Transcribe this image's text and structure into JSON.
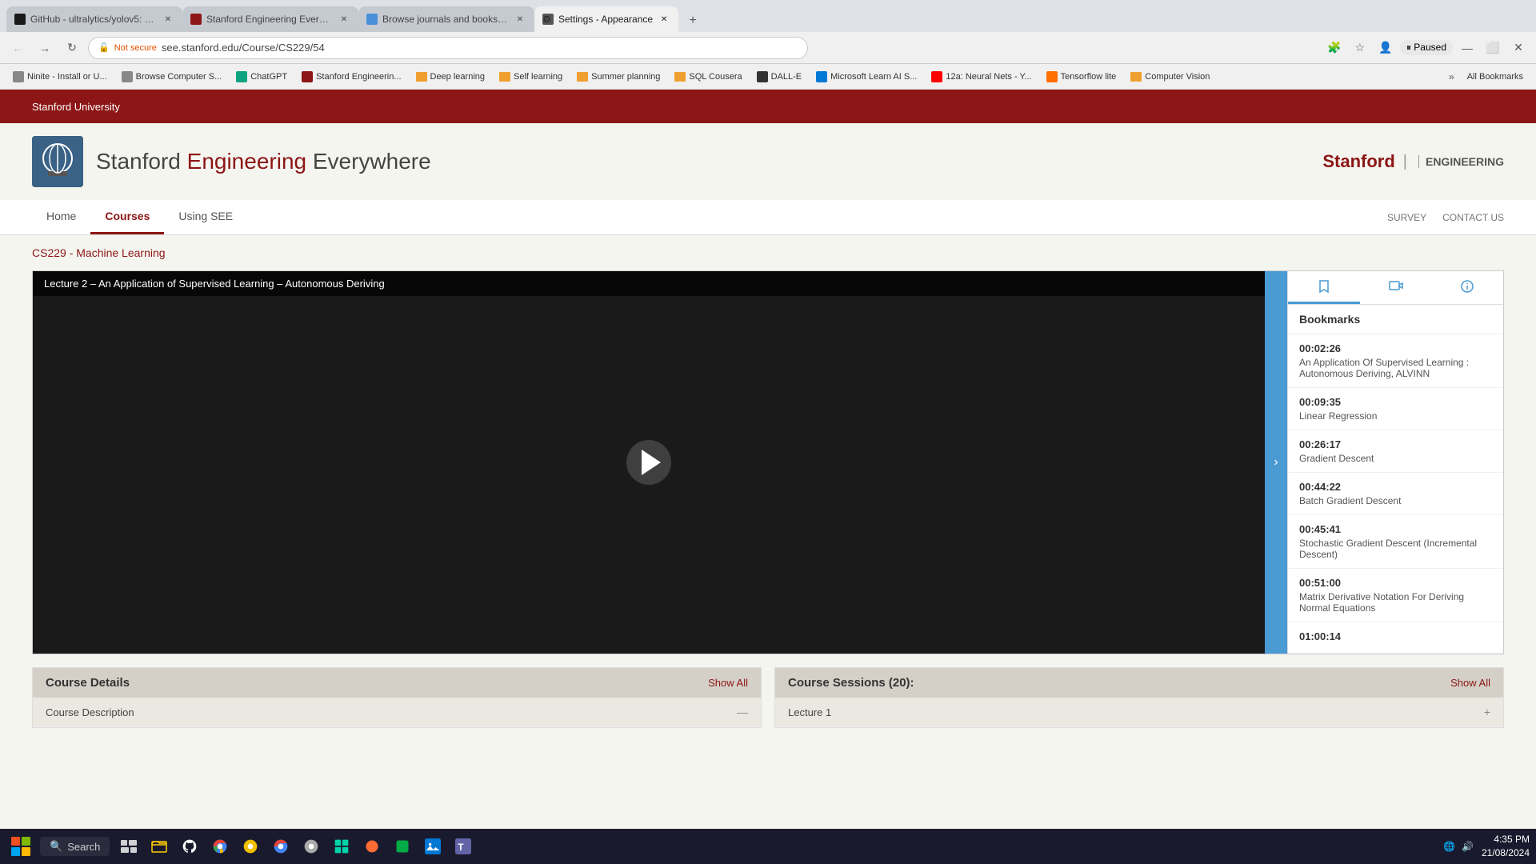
{
  "browser": {
    "tabs": [
      {
        "id": "tab1",
        "title": "GitHub - ultralytics/yolov5: YO...",
        "active": false,
        "favicon_color": "#1a1a1a"
      },
      {
        "id": "tab2",
        "title": "Stanford Engineering Everywhe...",
        "active": false,
        "favicon_color": "#8c1515"
      },
      {
        "id": "tab3",
        "title": "Browse journals and books | Sc...",
        "active": false,
        "favicon_color": "#4a90d9"
      },
      {
        "id": "tab4",
        "title": "Settings - Appearance",
        "active": true,
        "favicon_color": "#555"
      }
    ],
    "address": "see.stanford.edu/Course/CS229/54",
    "security_label": "Not secure"
  },
  "bookmarks": [
    {
      "label": "Ninite - Install or U...",
      "type": "site"
    },
    {
      "label": "Browse Computer S...",
      "type": "site"
    },
    {
      "label": "ChatGPT",
      "type": "site"
    },
    {
      "label": "Stanford Engineerin...",
      "type": "site"
    },
    {
      "label": "Deep learning",
      "type": "folder"
    },
    {
      "label": "Self learning",
      "type": "folder"
    },
    {
      "label": "Summer planning",
      "type": "folder"
    },
    {
      "label": "SQL Cousera",
      "type": "folder"
    },
    {
      "label": "DALL-E",
      "type": "site"
    },
    {
      "label": "Microsoft Learn AI S...",
      "type": "site"
    },
    {
      "label": "12a: Neural Nets - Y...",
      "type": "site"
    },
    {
      "label": "Tensorflow lite",
      "type": "site"
    },
    {
      "label": "Computer Vision",
      "type": "site"
    }
  ],
  "page": {
    "stanford_link": "Stanford University",
    "title": "Stanford Engineering Everywhere",
    "nav": {
      "items": [
        "Home",
        "Courses",
        "Using SEE"
      ],
      "active": "Courses",
      "right_items": [
        "SURVEY",
        "CONTACT US"
      ]
    },
    "breadcrumb": "CS229 - Machine Learning",
    "video": {
      "title": "Lecture 2 – An Application of Supervised Learning – Autonomous Deriving"
    },
    "panel": {
      "tabs": [
        "bookmark",
        "video",
        "info"
      ],
      "bookmarks_label": "Bookmarks",
      "entries": [
        {
          "time": "00:02:26",
          "desc": "An Application Of Supervised Learning : Autonomous Deriving, ALVINN"
        },
        {
          "time": "00:09:35",
          "desc": "Linear Regression"
        },
        {
          "time": "00:26:17",
          "desc": "Gradient Descent"
        },
        {
          "time": "00:44:22",
          "desc": "Batch Gradient Descent"
        },
        {
          "time": "00:45:41",
          "desc": "Stochastic Gradient Descent (Incremental Descent)"
        },
        {
          "time": "00:51:00",
          "desc": "Matrix Derivative Notation For Deriving Normal Equations"
        },
        {
          "time": "01:00:14",
          "desc": ""
        }
      ]
    },
    "course_details": {
      "header": "Course Details",
      "show_all": "Show All",
      "items": [
        {
          "title": "Course Description"
        }
      ]
    },
    "course_sessions": {
      "header": "Course Sessions (20):",
      "show_all": "Show All",
      "items": [
        {
          "title": "Lecture 1"
        }
      ]
    }
  },
  "taskbar": {
    "search_label": "Search",
    "time": "4:35 PM",
    "date": "21/08/2024"
  }
}
